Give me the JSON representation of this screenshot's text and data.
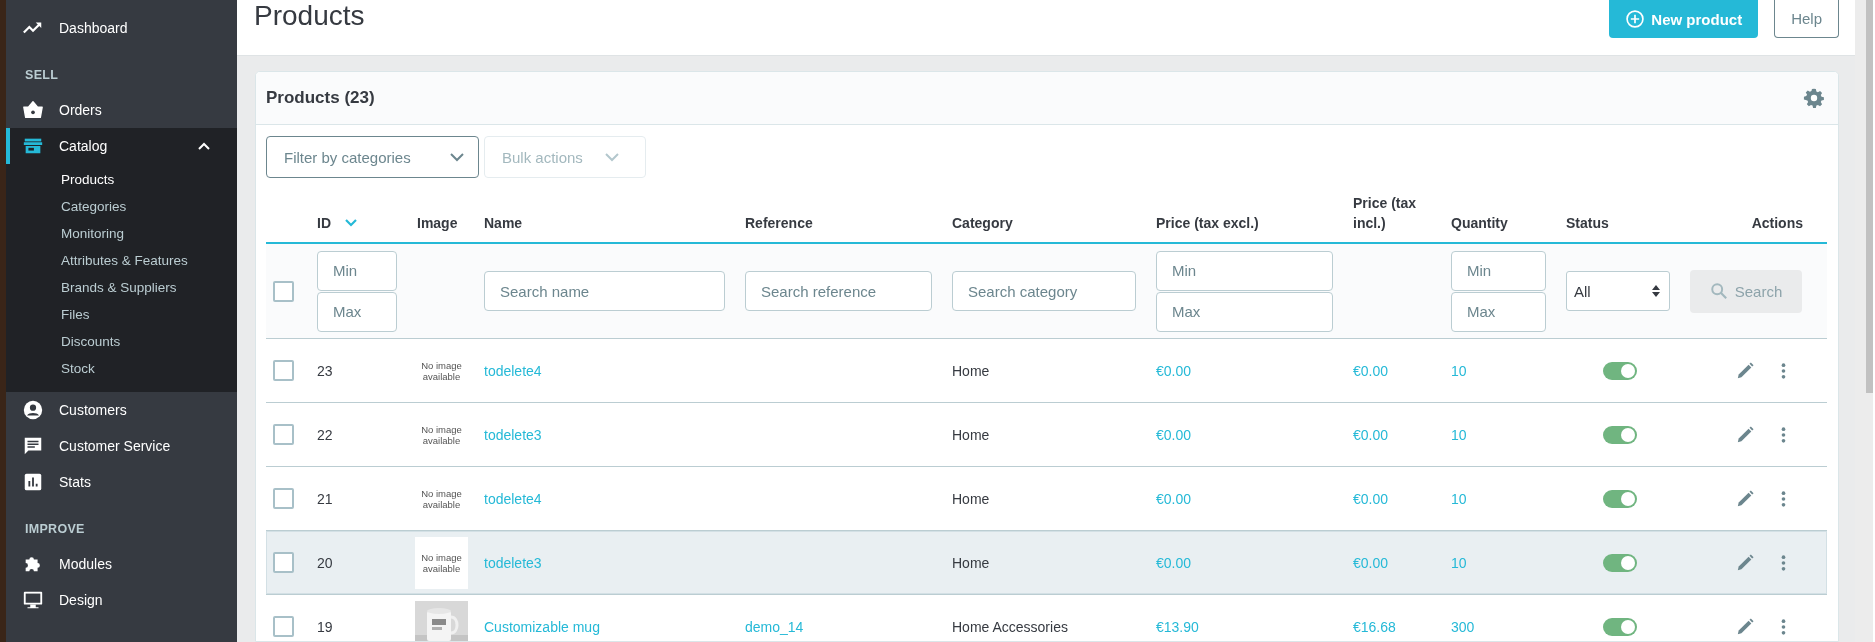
{
  "sidebar": {
    "items": [
      {
        "kind": "link",
        "label": "Dashboard",
        "selected": false
      },
      {
        "kind": "section",
        "label": "SELL"
      },
      {
        "kind": "link",
        "label": "Orders",
        "selected": false
      },
      {
        "kind": "link",
        "label": "Catalog",
        "selected": true,
        "expanded": true,
        "children": [
          {
            "label": "Products",
            "selected": true
          },
          {
            "label": "Categories",
            "selected": false
          },
          {
            "label": "Monitoring",
            "selected": false
          },
          {
            "label": "Attributes & Features",
            "selected": false
          },
          {
            "label": "Brands & Suppliers",
            "selected": false
          },
          {
            "label": "Files",
            "selected": false
          },
          {
            "label": "Discounts",
            "selected": false
          },
          {
            "label": "Stock",
            "selected": false
          }
        ]
      },
      {
        "kind": "link",
        "label": "Customers",
        "selected": false
      },
      {
        "kind": "link",
        "label": "Customer Service",
        "selected": false
      },
      {
        "kind": "link",
        "label": "Stats",
        "selected": false
      },
      {
        "kind": "section",
        "label": "IMPROVE"
      },
      {
        "kind": "link",
        "label": "Modules",
        "selected": false
      },
      {
        "kind": "link",
        "label": "Design",
        "selected": false
      }
    ]
  },
  "header": {
    "title": "Products",
    "buttons": [
      {
        "kind": "primary",
        "label": "New product"
      },
      {
        "kind": "outline",
        "label": "Help"
      }
    ]
  },
  "card": {
    "title": "Products (23)",
    "filter_button": "Filter by categories",
    "bulk_button": {
      "label": "Bulk actions",
      "disabled": true
    }
  },
  "table": {
    "columns": [
      {
        "label": "ID",
        "sorted": true
      },
      {
        "label": "Image"
      },
      {
        "label": "Name"
      },
      {
        "label": "Reference"
      },
      {
        "label": "Category"
      },
      {
        "label": "Price (tax excl.)"
      },
      {
        "label": "Price (tax incl.)"
      },
      {
        "label": "Quantity"
      },
      {
        "label": "Status"
      },
      {
        "label": "Actions"
      }
    ],
    "filters": [
      {
        "kind": "checkbox",
        "checked": false
      },
      {
        "kind": "range",
        "min_placeholder": "Min",
        "max_placeholder": "Max"
      },
      {
        "kind": "empty"
      },
      {
        "kind": "text",
        "placeholder": "Search name"
      },
      {
        "kind": "text",
        "placeholder": "Search reference"
      },
      {
        "kind": "text",
        "placeholder": "Search category"
      },
      {
        "kind": "range",
        "min_placeholder": "Min",
        "max_placeholder": "Max"
      },
      {
        "kind": "empty"
      },
      {
        "kind": "range",
        "min_placeholder": "Min",
        "max_placeholder": "Max"
      },
      {
        "kind": "select",
        "value": "All"
      },
      {
        "kind": "button",
        "label": "Search",
        "disabled": true
      }
    ],
    "rows": [
      {
        "checked": false,
        "hovered": false,
        "id": "23",
        "image": {
          "kind": "placeholder",
          "text": "No image available"
        },
        "name": "todelete4",
        "category": "Home",
        "price_excl": "€0.00",
        "price_incl": "€0.00",
        "quantity": "10",
        "active": true
      },
      {
        "checked": false,
        "hovered": false,
        "id": "22",
        "image": {
          "kind": "placeholder",
          "text": "No image available"
        },
        "name": "todelete3",
        "category": "Home",
        "price_excl": "€0.00",
        "price_incl": "€0.00",
        "quantity": "10",
        "active": true
      },
      {
        "checked": false,
        "hovered": false,
        "id": "21",
        "image": {
          "kind": "placeholder",
          "text": "No image available"
        },
        "name": "todelete4",
        "category": "Home",
        "price_excl": "€0.00",
        "price_incl": "€0.00",
        "quantity": "10",
        "active": true
      },
      {
        "checked": false,
        "hovered": true,
        "id": "20",
        "image": {
          "kind": "placeholder",
          "text": "No image available"
        },
        "name": "todelete3",
        "category": "Home",
        "price_excl": "€0.00",
        "price_incl": "€0.00",
        "quantity": "10",
        "active": true
      },
      {
        "checked": false,
        "hovered": false,
        "id": "19",
        "name": "Customizable mug",
        "reference": "demo_14",
        "category": "Home Accessories",
        "price_excl": "€13.90",
        "price_incl": "€16.68",
        "quantity": "300",
        "active": true
      }
    ]
  }
}
